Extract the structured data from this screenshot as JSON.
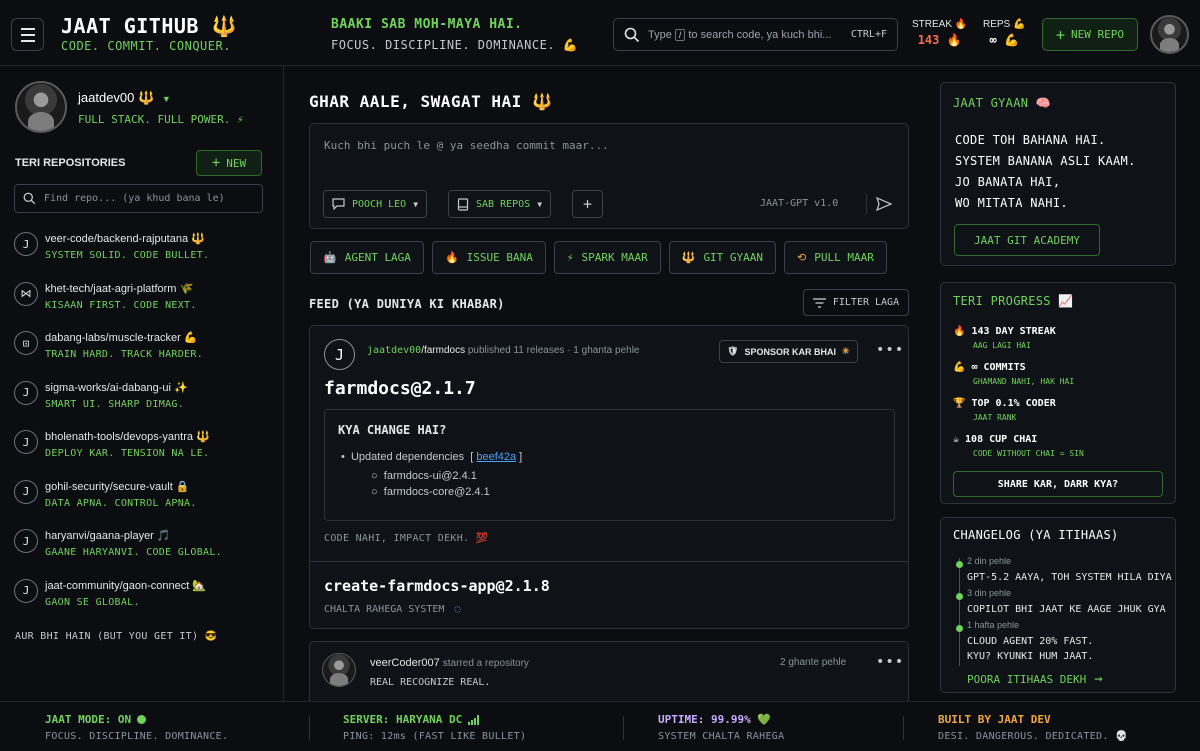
{
  "header": {
    "brand_title": "JAAT GITHUB",
    "brand_trident": "🔱",
    "brand_sub": "CODE. COMMIT. CONQUER.",
    "motto_1": "BAAKI SAB MOH-MAYA HAI.",
    "motto_2": "FOCUS. DISCIPLINE. DOMINANCE. 💪",
    "search_pre": "Type",
    "search_key": "/",
    "search_post": "to search code, ya kuch bhi...",
    "search_hint": "CTRL+F",
    "streak_label": "STREAK 🔥",
    "streak_value": "143 🔥",
    "reps_label": "REPS 💪",
    "reps_value": "∞ 💪",
    "new_repo_label": "NEW REPO"
  },
  "sidebar": {
    "username": "jaatdev00",
    "username_trident": "🔱",
    "tagline": "FULL STACK. FULL POWER. ⚡",
    "repos_title": "TERI REPOSITORIES",
    "new_label": "NEW",
    "find_placeholder": "Find repo... (ya khud bana le)",
    "repos": [
      {
        "icon": "J",
        "name": "veer-code/backend-rajputana 🔱",
        "desc": "SYSTEM SOLID. CODE BULLET."
      },
      {
        "icon": "⋈",
        "name": "khet-tech/jaat-agri-platform 🌾",
        "desc": "KISAAN FIRST. CODE NEXT."
      },
      {
        "icon": "⊡",
        "name": "dabang-labs/muscle-tracker 💪",
        "desc": "TRAIN HARD. TRACK HARDER."
      },
      {
        "icon": "J",
        "name": "sigma-works/ai-dabang-ui ✨",
        "desc": "SMART UI. SHARP DIMAG."
      },
      {
        "icon": "J",
        "name": "bholenath-tools/devops-yantra 🔱",
        "desc": "DEPLOY KAR. TENSION NA LE."
      },
      {
        "icon": "J",
        "name": "gohil-security/secure-vault 🔒",
        "desc": "DATA APNA. CONTROL APNA."
      },
      {
        "icon": "J",
        "name": "haryanvi/gaana-player 🎵",
        "desc": "GAANE HARYANVI. CODE GLOBAL."
      },
      {
        "icon": "J",
        "name": "jaat-community/gaon-connect 🏡",
        "desc": "GAON SE GLOBAL."
      }
    ],
    "more": "AUR BHI HAIN (BUT YOU GET IT) 😎"
  },
  "main": {
    "greeting": "GHAR AALE, SWAGAT HAI",
    "greeting_trident": "🔱",
    "compose_placeholder": "Kuch bhi puch le @ ya seedha commit maar...",
    "pooch_label": "POOCH LEO",
    "repos_label": "SAB REPOS",
    "model_label": "JAAT-GPT v1.0",
    "actions": [
      {
        "icon": "🤖",
        "label": "AGENT LAGA"
      },
      {
        "icon": "🔥",
        "label": "ISSUE BANA"
      },
      {
        "icon": "⚡",
        "label": "SPARK MAAR"
      },
      {
        "icon": "🔱",
        "label": "GIT GYAAN"
      },
      {
        "icon": "⟲",
        "label": "PULL MAAR"
      }
    ],
    "feed_title": "FEED (YA DUNIYA KI KHABAR)",
    "filter_label": "FILTER LAGA",
    "post": {
      "icon": "J",
      "user": "jaatdev00",
      "repo": "/farmdocs",
      "action": " published 11 releases · 1 ghanta pehle",
      "sponsor_label": "SPONSOR KAR BHAI",
      "release_title": "farmdocs@2.1.7",
      "changes_title": "KYA CHANGE HAI?",
      "change_line": "Updated dependencies",
      "change_link": "beef42a",
      "sub_changes": [
        "farmdocs-ui@2.4.1",
        "farmdocs-core@2.4.1"
      ],
      "impact": "CODE NAHI, IMPACT DEKH. 💯",
      "release_2": "create-farmdocs-app@2.1.8",
      "release_2_sub": "CHALTA RAHEGA SYSTEM"
    },
    "post2": {
      "user": "veerCoder007",
      "action": "starred a repository",
      "time": "2 ghante pehle",
      "sub": "REAL RECOGNIZE REAL."
    }
  },
  "right": {
    "gyaan_title": "JAAT GYAAN 🧠",
    "gyaan_lines": [
      "CODE TOH BAHANA HAI.",
      "SYSTEM BANANA ASLI KAAM.",
      "JO BANATA HAI,",
      "WO MITATA NAHI."
    ],
    "academy_label": "JAAT GIT ACADEMY",
    "progress_title": "TERI PROGRESS 📈",
    "progress": [
      {
        "icon": "🔥",
        "head": "143 DAY STREAK",
        "sub": "AAG LAGI HAI"
      },
      {
        "icon": "💪",
        "head": "∞ COMMITS",
        "sub": "GHAMAND NAHI, HAK HAI"
      },
      {
        "icon": "🏆",
        "head": "TOP 0.1% CODER",
        "sub": "JAAT RANK"
      },
      {
        "icon": "☕",
        "head": "108 CUP CHAI",
        "sub": "CODE WITHOUT CHAI = SIN"
      }
    ],
    "share_label": "SHARE KAR, DARR KYA?",
    "changelog_title": "CHANGELOG (YA ITIHAAS)",
    "changelog": [
      {
        "date": "2 din pehle",
        "text": "GPT-5.2 AAYA, TOH SYSTEM HILA DIYA"
      },
      {
        "date": "3 din pehle",
        "text": "COPILOT BHI JAAT KE AAGE JHUK GYA"
      },
      {
        "date": "1 hafta pehle",
        "text": "CLOUD AGENT 20% FAST.\nKYU? KYUNKI HUM JAAT."
      }
    ],
    "changelog_more": "POORA ITIHAAS DEKH"
  },
  "footer": {
    "mode_head": "JAAT MODE: ON",
    "mode_sub": "FOCUS. DISCIPLINE. DOMINANCE.",
    "server_head": "SERVER: HARYANA DC",
    "server_sub": "PING: 12ms (FAST LIKE BULLET)",
    "uptime_head": "UPTIME: 99.99% 💚",
    "uptime_sub": "SYSTEM CHALTA RAHEGA",
    "built_head": "BUILT BY JAAT DEV",
    "built_sub": "DESI. DANGEROUS. DEDICATED. 💀"
  },
  "colors": {
    "accent": "#6fd35a",
    "orange": "#f0a640",
    "background": "#0b0d10"
  }
}
